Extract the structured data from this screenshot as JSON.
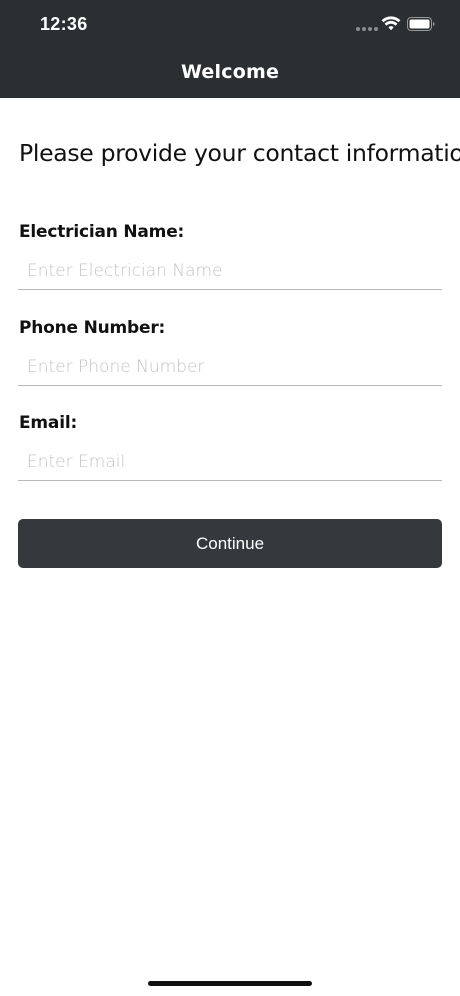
{
  "status_bar": {
    "time": "12:36",
    "signal_icon": "signal-dots-icon",
    "wifi_icon": "wifi-icon",
    "battery_icon": "battery-icon"
  },
  "nav": {
    "title": "Welcome"
  },
  "form": {
    "heading": "Please provide your contact information",
    "fields": [
      {
        "label": "Electrician Name:",
        "placeholder": "Enter Electrician Name",
        "value": ""
      },
      {
        "label": "Phone Number:",
        "placeholder": "Enter Phone Number",
        "value": ""
      },
      {
        "label": "Email:",
        "placeholder": "Enter Email",
        "value": ""
      }
    ],
    "submit_label": "Continue"
  },
  "colors": {
    "header_bg": "#2b2f31",
    "button_bg": "#35393d",
    "placeholder": "#c4c4c4",
    "divider": "#b8b8b8"
  }
}
